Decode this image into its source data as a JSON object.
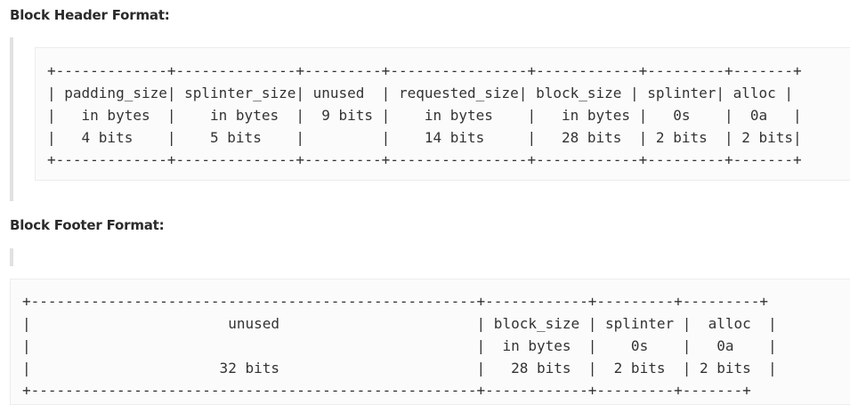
{
  "header_section": {
    "title": "Block Header Format:",
    "diagram_lines": [
      "+-------------+--------------+---------+----------------+------------+---------+-------+",
      "| padding_size| splinter_size| unused  | requested_size| block_size | splinter| alloc |",
      "|   in bytes  |    in bytes  |  9 bits |    in bytes    |   in bytes |   0s    |  0a   |",
      "|   4 bits    |    5 bits    |         |    14 bits     |   28 bits  | 2 bits  | 2 bits|",
      "+-------------+--------------+---------+----------------+------------+---------+-------+"
    ]
  },
  "footer_section": {
    "title": "Block Footer Format:",
    "diagram_lines": [
      "+----------------------------------------------------+------------+---------+---------+",
      "|                       unused                       | block_size | splinter |  alloc  |",
      "|                                                    |  in bytes  |    0s    |   0a    |",
      "|                      32 bits                       |   28 bits  |  2 bits  | 2 bits  |",
      "+----------------------------------------------------+------------+---------+-------+"
    ]
  }
}
